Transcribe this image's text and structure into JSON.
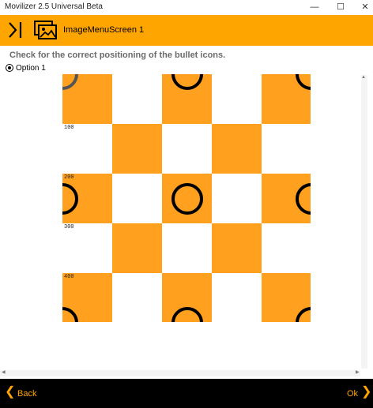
{
  "window": {
    "title": "Movilizer 2.5 Universal Beta",
    "minimize_glyph": "—",
    "maximize_glyph": "☐",
    "close_glyph": "✕"
  },
  "appbar": {
    "screen_title": "ImageMenuScreen 1",
    "accent_color": "#ffa500"
  },
  "content": {
    "instruction": "Check for the correct positioning of the bullet icons.",
    "option_label": "Option 1",
    "option_selected": true,
    "grid": {
      "rows": 5,
      "cols": 5,
      "cell_colors": [
        "#ffa01e",
        "#ffffff"
      ],
      "row_labels": [
        "100",
        "200",
        "300",
        "400"
      ]
    }
  },
  "bottom_bar": {
    "back_label": "Back",
    "ok_label": "Ok",
    "back_icon": "chevron-left-icon",
    "ok_icon": "chevron-right-icon"
  }
}
